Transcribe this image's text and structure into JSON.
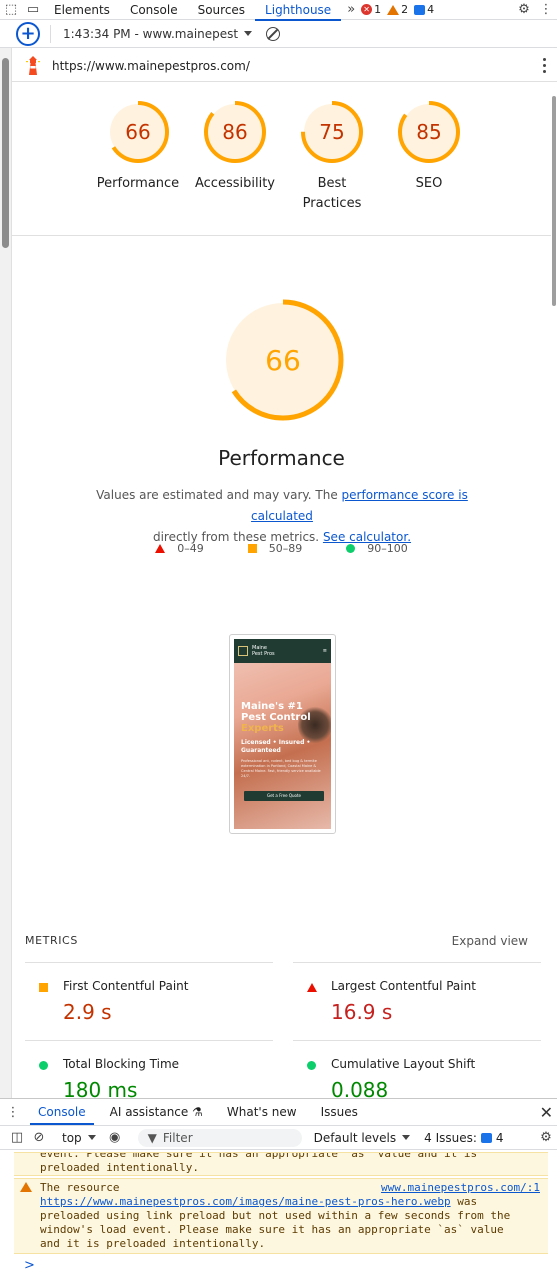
{
  "devtools": {
    "tabs": [
      "Elements",
      "Console",
      "Sources",
      "Lighthouse"
    ],
    "active_tab": "Lighthouse",
    "errors": "1",
    "warnings": "2",
    "infos": "4"
  },
  "lighthouse": {
    "report_select": "1:43:34 PM - www.mainepest",
    "url": "https://www.mainepestpros.com/"
  },
  "scores": [
    {
      "name": "Performance",
      "value": 66,
      "display": "66",
      "color": "#ffa400"
    },
    {
      "name": "Accessibility",
      "value": 86,
      "display": "86",
      "color": "#ffa400"
    },
    {
      "name": "Best Practices",
      "value": 75,
      "display": "75",
      "color": "#ffa400"
    },
    {
      "name": "SEO",
      "value": 85,
      "display": "85",
      "color": "#ffa400"
    }
  ],
  "score_labels": {
    "perf": "Performance",
    "a11y": "Accessibility",
    "bp_1": "Best",
    "bp_2": "Practices",
    "seo": "SEO"
  },
  "big_gauge": {
    "value": 66,
    "display": "66",
    "title": "Performance",
    "desc_1": "Values are estimated and may vary. The ",
    "desc_link_1": "performance score is calculated",
    "desc_2": "directly from these metrics. ",
    "desc_link_2": "See calculator."
  },
  "legend": {
    "red": "0–49",
    "orange": "50–89",
    "green": "90–100"
  },
  "thumbnail": {
    "brand_1": "Maine",
    "brand_2": "Pest Pros",
    "heading_1": "Maine's #1",
    "heading_2": "Pest Control",
    "heading_3": "Experts",
    "sub": "Licensed • Insured • Guaranteed",
    "para": "Professional ant, rodent, bed bug & termite extermination in Portland, Coastal Maine & Central Maine. Fast, friendly service available 24/7.",
    "button": "Get a Free Quote"
  },
  "metrics": {
    "title": "METRICS",
    "expand": "Expand view",
    "items": [
      {
        "label": "First Contentful Paint",
        "value": "2.9 s",
        "status": "orange"
      },
      {
        "label": "Largest Contentful Paint",
        "value": "16.9 s",
        "status": "red"
      },
      {
        "label": "Total Blocking Time",
        "value": "180 ms",
        "status": "green"
      },
      {
        "label": "Cumulative Layout Shift",
        "value": "0.088",
        "status": "green"
      }
    ]
  },
  "drawer": {
    "tabs": [
      "Console",
      "AI assistance",
      "What's new",
      "Issues"
    ],
    "context": "top",
    "filter_placeholder": "Filter",
    "levels": "Default levels",
    "issues_label": "4 Issues:",
    "issues_count": "4"
  },
  "console": {
    "prev_warning_tail_1": "event. Please make sure it has an appropriate `as` value and it is",
    "prev_warning_tail_2": "preloaded intentionally.",
    "warning_prefix": "The resource",
    "warning_source": "www.mainepestpros.com/:1",
    "warning_url": "https://www.mainepestpros.com/images/maine-pest-pros-hero.webp",
    "warning_rest_1": " was",
    "warning_rest_2": "preloaded using link preload but not used within a few seconds from the",
    "warning_rest_3": "window's load event. Please make sure it has an appropriate `as` value",
    "warning_rest_4": "and it is preloaded intentionally.",
    "prompt": ">"
  },
  "colors": {
    "accent": "#0b57d0",
    "orange": "#ffa400",
    "orange_text": "#c33300",
    "red_text": "#c5221f",
    "green_text": "#008800"
  }
}
